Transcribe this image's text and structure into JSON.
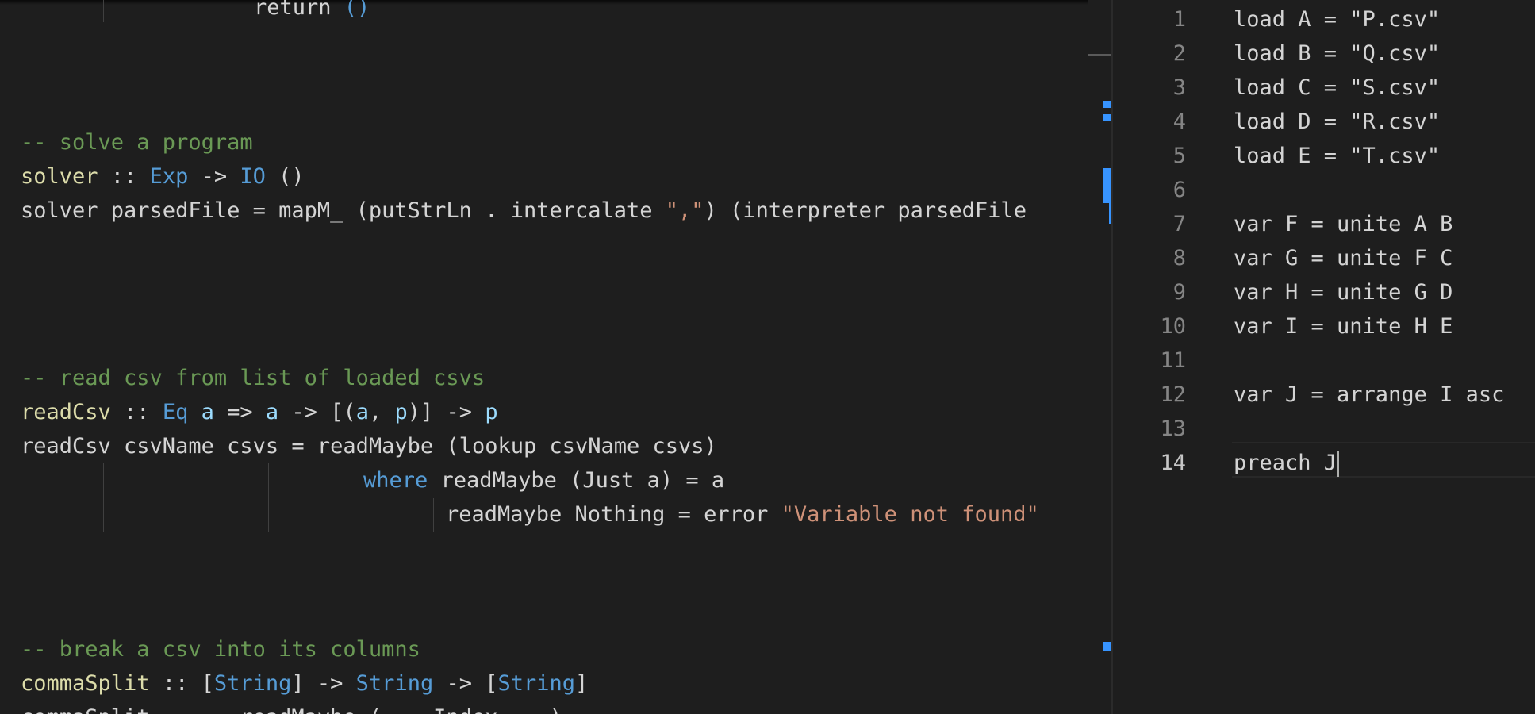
{
  "editor_left": {
    "lines": [
      {
        "tokens": [
          {
            "t": "return ",
            "c": "plain"
          },
          {
            "t": "()",
            "c": "type2"
          }
        ]
      },
      {
        "tokens": [
          {
            "t": "-- solve a program",
            "c": "comment"
          }
        ]
      },
      {
        "tokens": [
          {
            "t": "solver",
            "c": "func"
          },
          {
            "t": " :: ",
            "c": "plain"
          },
          {
            "t": "Exp",
            "c": "type2"
          },
          {
            "t": " -> ",
            "c": "plain"
          },
          {
            "t": "IO",
            "c": "type2"
          },
          {
            "t": " ()",
            "c": "plain"
          }
        ]
      },
      {
        "tokens": [
          {
            "t": "solver parsedFile = mapM_ (putStrLn . intercalate ",
            "c": "plain"
          },
          {
            "t": "\",\"",
            "c": "str"
          },
          {
            "t": ") (interpreter parsedFile",
            "c": "plain"
          }
        ]
      },
      {
        "tokens": [
          {
            "t": "-- read csv from list of loaded csvs",
            "c": "comment"
          }
        ]
      },
      {
        "tokens": [
          {
            "t": "readCsv",
            "c": "func"
          },
          {
            "t": " :: ",
            "c": "plain"
          },
          {
            "t": "Eq",
            "c": "type2"
          },
          {
            "t": " ",
            "c": "plain"
          },
          {
            "t": "a",
            "c": "var"
          },
          {
            "t": " => ",
            "c": "plain"
          },
          {
            "t": "a",
            "c": "var"
          },
          {
            "t": " -> [(",
            "c": "plain"
          },
          {
            "t": "a",
            "c": "var"
          },
          {
            "t": ", ",
            "c": "plain"
          },
          {
            "t": "p",
            "c": "var"
          },
          {
            "t": ")] -> ",
            "c": "plain"
          },
          {
            "t": "p",
            "c": "var"
          }
        ]
      },
      {
        "tokens": [
          {
            "t": "readCsv csvName csvs = readMaybe (lookup csvName csvs)",
            "c": "plain"
          }
        ]
      },
      {
        "tokens": [
          {
            "t": "where",
            "c": "kw"
          },
          {
            "t": " readMaybe (Just a) = a",
            "c": "plain"
          }
        ]
      },
      {
        "tokens": [
          {
            "t": "readMaybe Nothing = error ",
            "c": "plain"
          },
          {
            "t": "\"Variable not found\"",
            "c": "str"
          }
        ]
      },
      {
        "tokens": [
          {
            "t": "-- break a csv into its columns",
            "c": "comment"
          }
        ]
      },
      {
        "tokens": [
          {
            "t": "commaSplit",
            "c": "func"
          },
          {
            "t": " :: [",
            "c": "plain"
          },
          {
            "t": "String",
            "c": "type2"
          },
          {
            "t": "] -> ",
            "c": "plain"
          },
          {
            "t": "String",
            "c": "type2"
          },
          {
            "t": " -> [",
            "c": "plain"
          },
          {
            "t": "String",
            "c": "type2"
          },
          {
            "t": "]",
            "c": "plain"
          }
        ]
      },
      {
        "tokens": [
          {
            "t": "commaSplit ... = readMaybe (... Index ...)",
            "c": "plain"
          }
        ]
      }
    ]
  },
  "editor_right": {
    "lines": [
      {
        "n": "1",
        "text": "load A = \"P.csv\""
      },
      {
        "n": "2",
        "text": "load B = \"Q.csv\""
      },
      {
        "n": "3",
        "text": "load C = \"S.csv\""
      },
      {
        "n": "4",
        "text": "load D = \"R.csv\""
      },
      {
        "n": "5",
        "text": "load E = \"T.csv\""
      },
      {
        "n": "6",
        "text": ""
      },
      {
        "n": "7",
        "text": "var F = unite A B"
      },
      {
        "n": "8",
        "text": "var G = unite F C"
      },
      {
        "n": "9",
        "text": "var H = unite G D"
      },
      {
        "n": "10",
        "text": "var I = unite H E"
      },
      {
        "n": "11",
        "text": ""
      },
      {
        "n": "12",
        "text": "var J = arrange I asc"
      },
      {
        "n": "13",
        "text": ""
      },
      {
        "n": "14",
        "text": "preach J"
      }
    ]
  },
  "colors": {
    "background": "#1e1e1e",
    "comment": "#6a9955",
    "function": "#dcdcaa",
    "type": "#569cd6",
    "string": "#ce9178",
    "variable": "#9cdcfe"
  }
}
